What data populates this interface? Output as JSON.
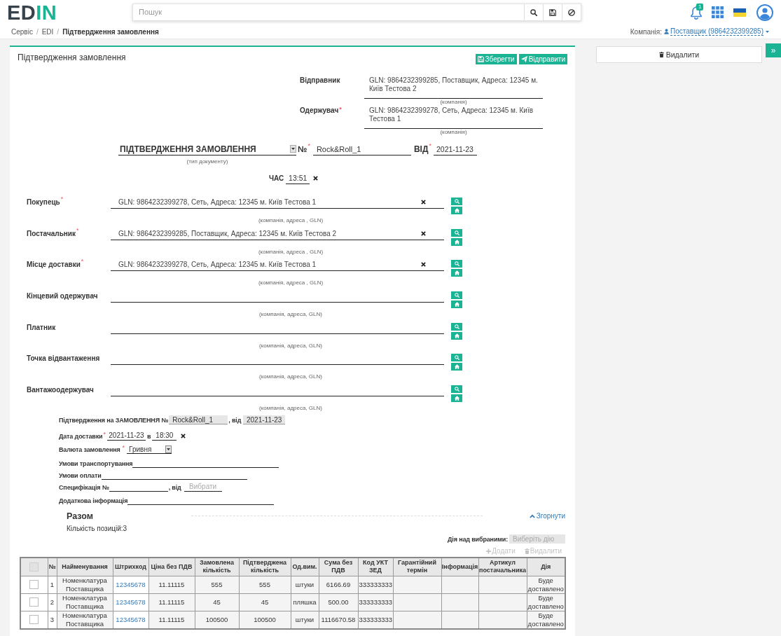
{
  "header": {
    "logo": [
      "ED",
      "IN"
    ],
    "search": {
      "placeholder": "Пошук"
    },
    "notifications": "1"
  },
  "breadcrumbs": {
    "separator": "/",
    "items": [
      {
        "label": "Сервіс",
        "current": false
      },
      {
        "label": "EDI",
        "current": false
      },
      {
        "label": "Підтвердження замовлення",
        "current": true
      }
    ]
  },
  "company": {
    "label": "Компанія:",
    "value": "Поставщик (9864232399285)"
  },
  "form": {
    "title": "Підтвердження замовлення",
    "actions": [
      {
        "label": "Зберегти",
        "kind": "save"
      },
      {
        "label": "Відправити",
        "kind": "send"
      }
    ],
    "correspondents": [
      {
        "label": "Відправник",
        "value": "GLN: 9864232399285, Поставщик, Адреса: 12345 м. Київ Тестова 2",
        "hint": "(компанія)"
      },
      {
        "label": "Одержувач",
        "required_mark": "*",
        "value": "GLN: 9864232399278, Сеть, Адреса: 12345 м. Київ Тестова 1",
        "hint": "(компанія)"
      }
    ],
    "document": {
      "type": "ПІДТВЕРДЖЕННЯ ЗАМОВЛЕННЯ",
      "type_hint": "(тип документу)",
      "number_label": "№",
      "number_required_mark": "*",
      "number": "Rock&Roll_1",
      "date_label": "ВІД",
      "date_required_mark": "*",
      "date": "2021-11-23",
      "time_label": "ЧАС",
      "time": "13:51"
    },
    "parties": [
      {
        "label": "Покупець",
        "required_mark": "*",
        "value": "GLN: 9864232399278, Сеть, Адреса: 12345 м. Київ Тестова 1",
        "hint": "(компанія, адреса , GLN)"
      },
      {
        "label": "Постачальник",
        "required_mark": "*",
        "value": "GLN: 9864232399285, Поставщик, Адреса: 12345 м. Київ Тестова 2",
        "hint": "(компанія, адреса , GLN)"
      },
      {
        "label": "Місце доставки",
        "required_mark": "*",
        "value": "GLN: 9864232399278, Сеть, Адреса: 12345 м. Київ Тестова 1",
        "hint": "(компанія, адреса , GLN)"
      },
      {
        "label": "Кінцевий одержувач",
        "hint": "(компанія, адреса, GLN)"
      },
      {
        "label": "Платник",
        "hint": "(компанія, адреса, GLN)"
      },
      {
        "label": "Точка відвантаження",
        "hint": "(компанія, адреса, GLN)"
      },
      {
        "label": "Вантажоодержувач",
        "hint": "(компанія, адреса, GLN)"
      }
    ],
    "order_reference": {
      "label": "Підтвердження на ЗАМОВЛЕННЯ №",
      "number": "Rock&Roll_1",
      "date_label": ", від",
      "date": "2021-11-23"
    },
    "delivery": {
      "label": "Дата доставки",
      "required_mark": "*",
      "date": "2021-11-23",
      "time_label": "в",
      "time": "18:30"
    },
    "currency": {
      "label": "Валюта замовлення",
      "required_mark": "*",
      "value": "Гривня"
    },
    "terms": [
      {
        "kind": "line",
        "label": "Умови транспортування"
      },
      {
        "kind": "line",
        "label": "Умови оплати"
      },
      {
        "kind": "specification",
        "label": "Специфікація №",
        "date_label": ", від",
        "date_placeholder": "Вибрати"
      },
      {
        "kind": "line",
        "label": "Додаткова інформація"
      }
    ],
    "summary": {
      "title": "Разом",
      "collapse_link": "Згорнути",
      "positions": "Кількість позицій:3"
    },
    "bulk_action": {
      "label": "Дія над вибраними:",
      "placeholder": "Виберіть дію"
    },
    "item_buttons": [
      {
        "label": "Додати",
        "kind": "add",
        "disabled": true
      },
      {
        "label": "Видалити",
        "kind": "delete",
        "disabled": true
      }
    ],
    "table": {
      "select_all": {
        "checked": false
      },
      "columns": [
        "№",
        "Найменування",
        "Штрихкод",
        "Ціна без ПДВ",
        "Замовлена кількість",
        "Підтверджена кількість",
        "Од.вим.",
        "Сума без ПДВ",
        "Код УКТ ЗЕД",
        "Гарантійний термін",
        "Інформація",
        "Артикул постачальника",
        "Дія"
      ],
      "rows": [
        {
          "selected": false,
          "no": "1",
          "name": "Номенклатура Поставщика",
          "barcode": "12345678",
          "price": "11.11115",
          "ordered": "555",
          "confirmed": "555",
          "unit": "штуки",
          "sum": "6166.69",
          "uktzed": "333333333",
          "action": "Буде доставлено"
        },
        {
          "selected": false,
          "no": "2",
          "name": "Номенклатура Поставщика",
          "barcode": "12345678",
          "price": "11.11115",
          "ordered": "45",
          "confirmed": "45",
          "unit": "пляшка",
          "sum": "500.00",
          "uktzed": "333333333",
          "action": "Буде доставлено"
        },
        {
          "selected": false,
          "no": "3",
          "name": "Номенклатура Поставщика",
          "barcode": "12345678",
          "price": "11.11115",
          "ordered": "100500",
          "confirmed": "100500",
          "unit": "штуки",
          "sum": "1116670.58",
          "uktzed": "333333333",
          "action": "Буде доставлено"
        }
      ]
    }
  },
  "sidebar": {
    "delete_button": "Видалити",
    "toggle": "»"
  }
}
